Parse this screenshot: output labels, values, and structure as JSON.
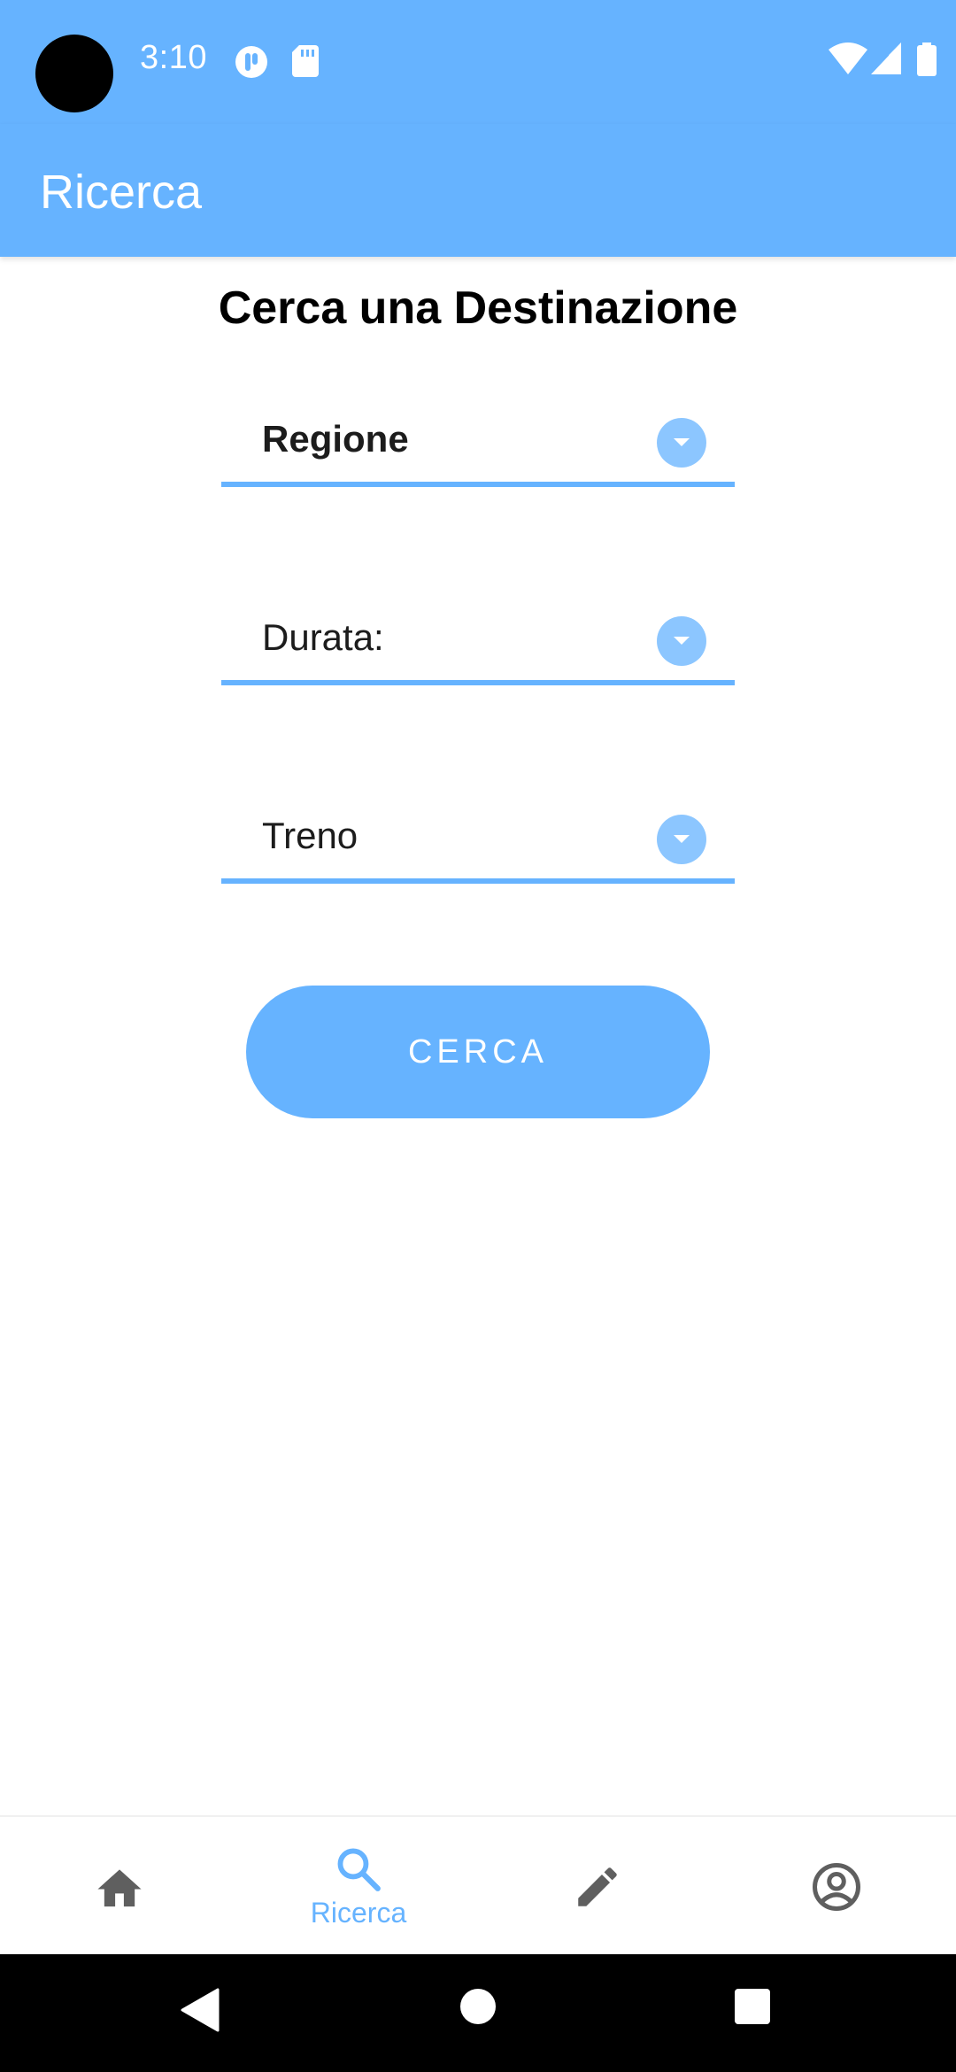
{
  "status_bar": {
    "time": "3:10",
    "icons": [
      "camera-cutout",
      "notification-app-icon",
      "sd-card-icon",
      "wifi-icon",
      "cell-signal-icon",
      "battery-icon"
    ]
  },
  "app_bar": {
    "title": "Ricerca"
  },
  "content": {
    "heading": "Cerca una Destinazione",
    "dropdowns": [
      {
        "value": "Regione",
        "icon": "chevron-down-icon"
      },
      {
        "value": "Durata:",
        "icon": "chevron-down-icon"
      },
      {
        "value": "Treno",
        "icon": "chevron-down-icon"
      }
    ],
    "search_button_label": "CERCA"
  },
  "bottom_nav": {
    "items": [
      {
        "icon": "home-icon",
        "label": ""
      },
      {
        "icon": "search-icon",
        "label": "Ricerca",
        "selected": true
      },
      {
        "icon": "pencil-icon",
        "label": ""
      },
      {
        "icon": "account-icon",
        "label": ""
      }
    ]
  },
  "system_nav": {
    "icons": [
      "back-icon",
      "home-circle-icon",
      "recents-icon"
    ]
  },
  "colors": {
    "accent": "#66b3ff",
    "accent_light": "#8cc6ff",
    "nav_icon_inactive": "#5f5f5f"
  }
}
